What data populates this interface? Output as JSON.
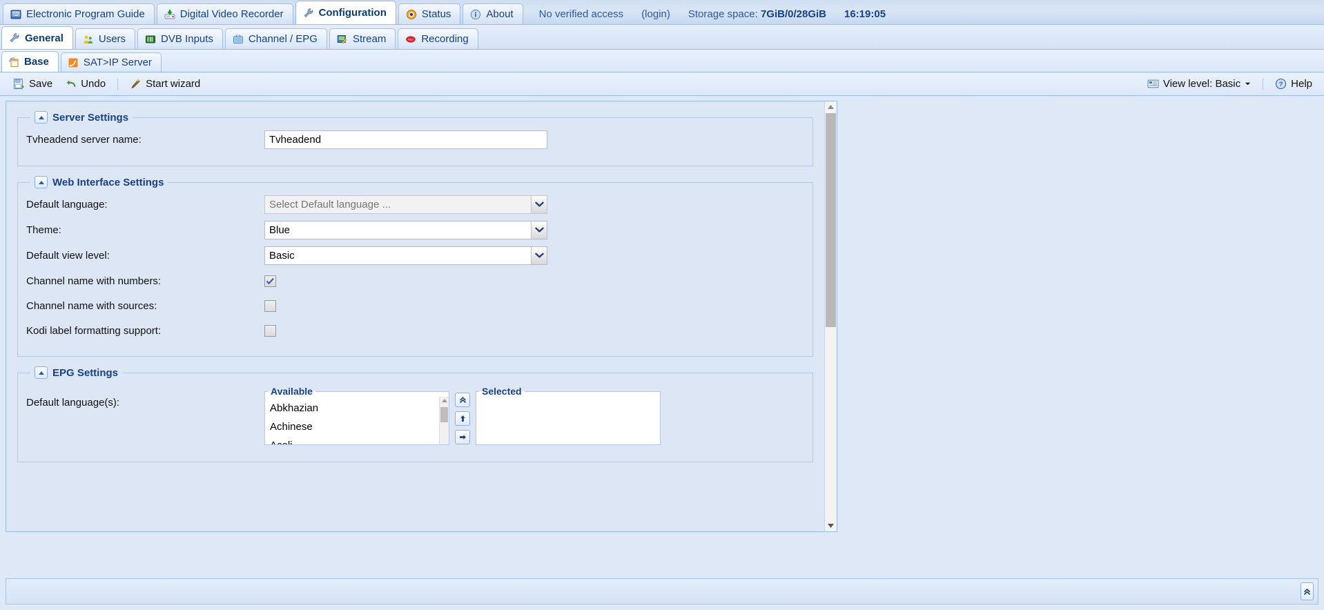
{
  "topnav": {
    "tabs": [
      {
        "label": "Electronic Program Guide",
        "icon": "epg-icon",
        "active": false
      },
      {
        "label": "Digital Video Recorder",
        "icon": "dvr-icon",
        "active": false
      },
      {
        "label": "Configuration",
        "icon": "wrench-icon",
        "active": true
      },
      {
        "label": "Status",
        "icon": "eye-icon",
        "active": false
      },
      {
        "label": "About",
        "icon": "info-icon",
        "active": false
      }
    ],
    "access_text": "No verified access",
    "login_text": "(login)",
    "storage_label": "Storage space:",
    "storage_value": "7GiB/0/28GiB",
    "clock": "16:19:05"
  },
  "subnav": {
    "tabs": [
      {
        "label": "General",
        "icon": "wrench-icon",
        "active": true
      },
      {
        "label": "Users",
        "icon": "users-icon",
        "active": false
      },
      {
        "label": "DVB Inputs",
        "icon": "dvb-icon",
        "active": false
      },
      {
        "label": "Channel / EPG",
        "icon": "tv-icon",
        "active": false
      },
      {
        "label": "Stream",
        "icon": "stream-icon",
        "active": false
      },
      {
        "label": "Recording",
        "icon": "rec-icon",
        "active": false
      }
    ]
  },
  "subsubnav": {
    "tabs": [
      {
        "label": "Base",
        "icon": "base-icon",
        "active": true
      },
      {
        "label": "SAT>IP Server",
        "icon": "satip-icon",
        "active": false
      }
    ]
  },
  "toolbar": {
    "save_label": "Save",
    "undo_label": "Undo",
    "wizard_label": "Start wizard",
    "viewlevel_label": "View level: Basic",
    "help_label": "Help"
  },
  "sections": {
    "server": {
      "title": "Server Settings",
      "server_name_label": "Tvheadend server name:",
      "server_name_value": "Tvheadend"
    },
    "web": {
      "title": "Web Interface Settings",
      "language_label": "Default language:",
      "language_placeholder": "Select Default language ...",
      "language_value": "",
      "theme_label": "Theme:",
      "theme_value": "Blue",
      "viewlevel_label": "Default view level:",
      "viewlevel_value": "Basic",
      "chan_numbers_label": "Channel name with numbers:",
      "chan_numbers_checked": true,
      "chan_sources_label": "Channel name with sources:",
      "chan_sources_checked": false,
      "kodi_label": "Kodi label formatting support:",
      "kodi_checked": false
    },
    "epg": {
      "title": "EPG Settings",
      "languages_label": "Default language(s):",
      "available_title": "Available",
      "selected_title": "Selected",
      "available_items": [
        "Abkhazian",
        "Achinese",
        "Acoli"
      ],
      "selected_items": []
    }
  },
  "colors": {
    "accent": "#15428b",
    "panel_bg": "#dce6f5",
    "border": "#99bbe8",
    "chrome_bg": "#dfe8f6"
  }
}
